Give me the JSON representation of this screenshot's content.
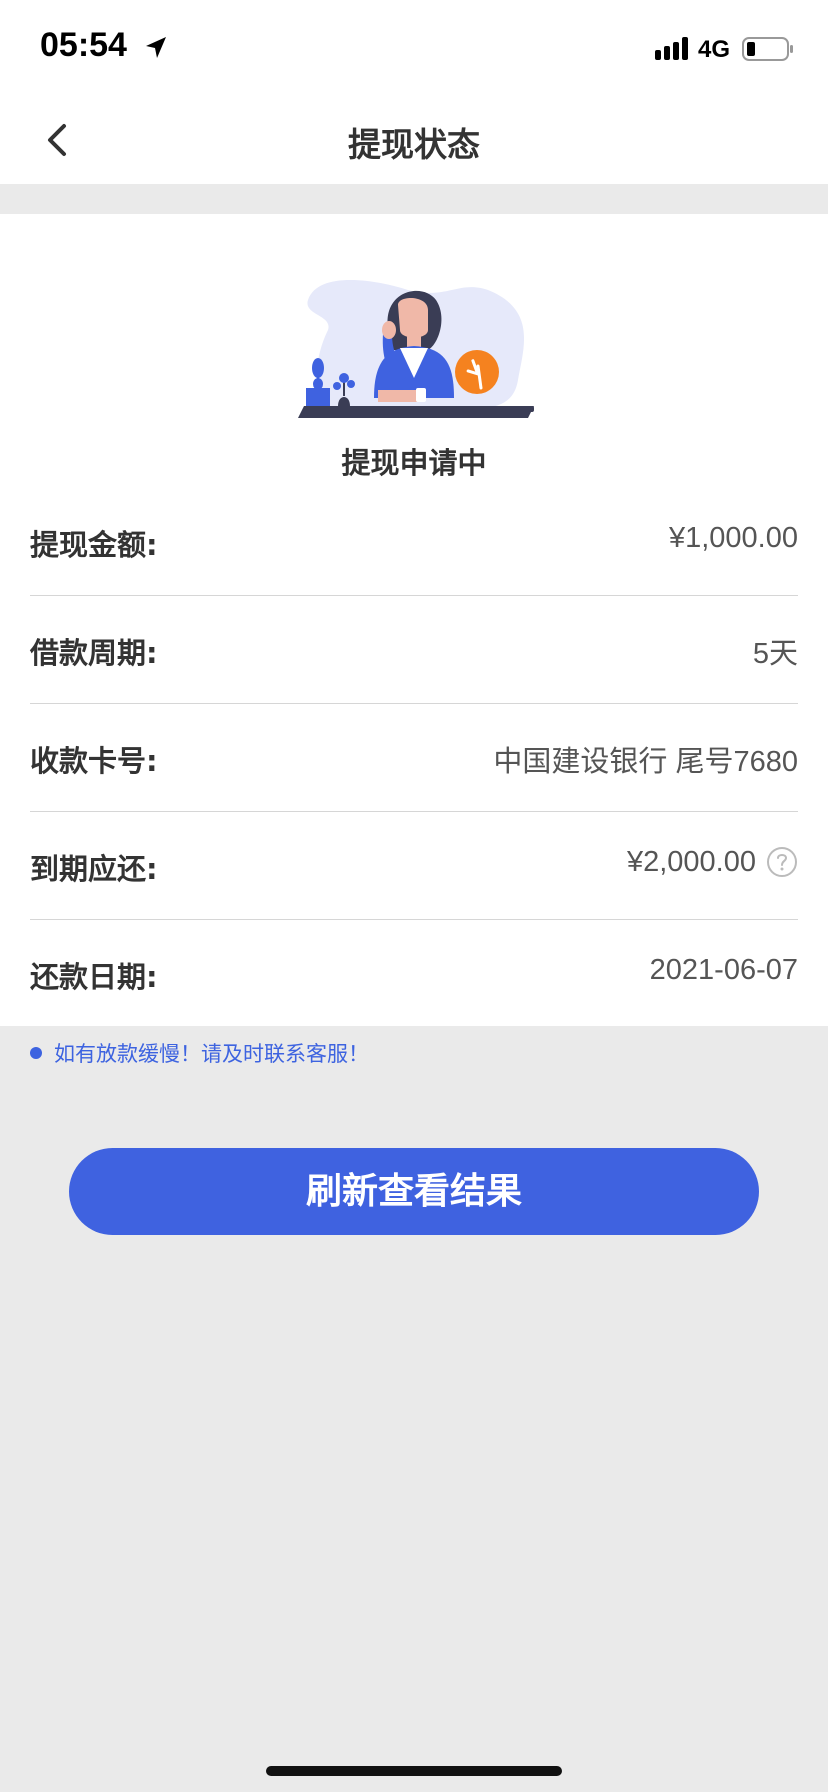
{
  "status_bar": {
    "time": "05:54",
    "network": "4G",
    "icons": [
      "location-arrow-icon",
      "signal-icon",
      "battery-icon"
    ]
  },
  "nav": {
    "title": "提现状态",
    "back_icon": "chevron-left-icon"
  },
  "status": {
    "illustration": "woman-waiting-clock-illustration",
    "text": "提现申请中"
  },
  "details": [
    {
      "label": "提现金额:",
      "value": "¥1,000.00"
    },
    {
      "label": "借款周期:",
      "value": "5天"
    },
    {
      "label": "收款卡号:",
      "value": "中国建设银行 尾号7680"
    },
    {
      "label": "到期应还:",
      "value": "¥2,000.00",
      "icon": "question-circle-icon"
    },
    {
      "label": "还款日期:",
      "value": "2021-06-07"
    }
  ],
  "notice": "如有放款缓慢！请及时联系客服！",
  "refresh_button": "刷新查看结果",
  "colors": {
    "accent": "#3f62e0",
    "clock_orange": "#f5821f",
    "background": "#eaeaea"
  }
}
